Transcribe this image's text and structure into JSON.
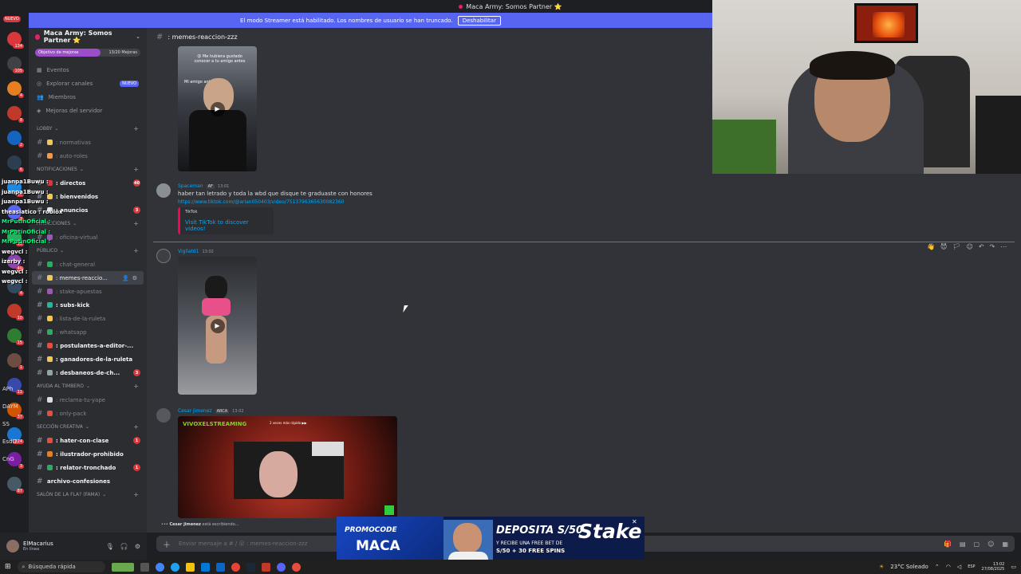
{
  "window": {
    "title": "Maca Army: Somos Partner ⭐"
  },
  "banner": {
    "text": "El modo Streamer está habilitado. Los nombres de usuario se han truncado.",
    "button": "Deshabilitar"
  },
  "rail": {
    "new_badge": "NUEVO",
    "badges": [
      "134",
      "105",
      "4",
      "8",
      "2",
      "6",
      "14",
      "3",
      "36",
      "40",
      "4",
      "10",
      "15",
      "1",
      "11",
      "37",
      "224",
      "3",
      "87"
    ],
    "labels": [
      "APh",
      "DAYM",
      "SS",
      "EsdD",
      "CnG"
    ]
  },
  "stream_chat": [
    {
      "name": "juanpa1Buwu :",
      "color": "#ffffff"
    },
    {
      "name": "juanpa1Buwu :",
      "color": "#ffffff"
    },
    {
      "name": "juanpa1Buwu :",
      "color": "#ffffff"
    },
    {
      "name": "theasiatico : roblox",
      "color": "#ffffff"
    },
    {
      "name": "MrPutinOficial :",
      "color": "#00ff7f"
    },
    {
      "name": "MrPutinOficial :",
      "color": "#00ff7f"
    },
    {
      "name": "MrPutinOficial :",
      "color": "#00ff7f"
    },
    {
      "name": "wegvcl :",
      "color": "#ffffff"
    },
    {
      "name": "izerby :",
      "color": "#ffffff"
    },
    {
      "name": "wegvcl :",
      "color": "#ffffff"
    },
    {
      "name": "wegvcl :",
      "color": "#ffffff"
    }
  ],
  "sidebar": {
    "server_name": "Maca Army: Somos Partner ⭐",
    "boost": {
      "label": "Objetivo de mejoras",
      "count": "13/20 Mejoras"
    },
    "nav": [
      {
        "label": "Eventos",
        "icon": "calendar-icon"
      },
      {
        "label": "Explorar canales",
        "icon": "compass-icon",
        "badge": "NUEVO"
      },
      {
        "label": "Miembros",
        "icon": "members-icon"
      },
      {
        "label": "Mejoras del servidor",
        "icon": "boost-icon"
      }
    ],
    "categories": [
      {
        "name": "LOBBY",
        "channels": [
          {
            "name": ": normativas",
            "unread": false,
            "emoji": "#f2c94c"
          },
          {
            "name": ": auto-roles",
            "unread": false,
            "emoji": "#f2994a"
          }
        ]
      },
      {
        "name": "NOTIFICACIONES",
        "channels": [
          {
            "name": ": directos",
            "unread": true,
            "emoji": "#da373c",
            "count": "40"
          },
          {
            "name": ": bienvenidos",
            "unread": true,
            "emoji": "#f2c94c"
          },
          {
            "name": ": anuncios",
            "unread": true,
            "emoji": "#dbdee1",
            "count": "3"
          }
        ]
      },
      {
        "name": "ATRACCIONES",
        "channels": [
          {
            "name": ": oficina-virtual",
            "unread": false,
            "emoji": "#9b59b6"
          }
        ]
      },
      {
        "name": "PÚBLICO",
        "channels": [
          {
            "name": ": chat-general",
            "unread": false,
            "emoji": "#27ae60"
          },
          {
            "name": ": memes-reaccio...",
            "unread": false,
            "emoji": "#f2c94c",
            "active": true
          },
          {
            "name": ": stake-apuestas",
            "unread": false,
            "emoji": "#9b59b6"
          },
          {
            "name": ": subs-kick",
            "unread": true,
            "emoji": "#1abc9c"
          },
          {
            "name": ": lista-de-la-ruleta",
            "unread": false,
            "emoji": "#f2c94c"
          },
          {
            "name": ": whatsapp",
            "unread": false,
            "emoji": "#27ae60"
          },
          {
            "name": ": postulantes-a-editor-...",
            "unread": true,
            "emoji": "#e74c3c"
          },
          {
            "name": ": ganadores-de-la-ruleta",
            "unread": true,
            "emoji": "#f2c94c"
          },
          {
            "name": ": desbaneos-de-ch...",
            "unread": true,
            "emoji": "#95a5a6",
            "count": "3"
          }
        ]
      },
      {
        "name": "AYUDA AL TIMBERO",
        "channels": [
          {
            "name": ": reclama-tu-yape",
            "unread": false,
            "emoji": "#dbdee1"
          },
          {
            "name": ": only-pack",
            "unread": false,
            "emoji": "#e74c3c"
          }
        ]
      },
      {
        "name": "SECCIÓN CREATIVA",
        "channels": [
          {
            "name": ": hater-con-clase",
            "unread": true,
            "emoji": "#e74c3c",
            "count": "1"
          },
          {
            "name": ": ilustrador-prohibido",
            "unread": true,
            "emoji": "#e67e22"
          },
          {
            "name": ": relator-tronchado",
            "unread": true,
            "emoji": "#27ae60",
            "count": "1"
          },
          {
            "name": "archivo-confesiones",
            "unread": true,
            "emoji": ""
          }
        ]
      },
      {
        "name": "SALÓN DE LA FLA? (FAMA)",
        "channels": []
      }
    ]
  },
  "user": {
    "name": "ElMacarius",
    "status": "En línea"
  },
  "channel": {
    "name": ": memes-reaccion-zzz"
  },
  "messages": [
    {
      "author": "Spaceman",
      "tag": "AF",
      "time": "13:01",
      "text": "haber tan letrado y toda la wbd que disque te graduaste con honores",
      "link": "https://www.tiktok.com/@arian050403/video/7513796365630082360",
      "embed": {
        "provider": "TikTok",
        "title": "Visit TikTok to discover videos!"
      }
    },
    {
      "author": "Vigilatd1",
      "tag": "",
      "time": "13:02"
    },
    {
      "author": "Cesar jimenez",
      "tag": "ARCA",
      "time": "13:02"
    }
  ],
  "video1": {
    "line1": "😮 Me hubiera gustado",
    "line2": "conocer a tu amigo antes",
    "line3": "Mi amigo antes :"
  },
  "video3": {
    "brand": "VIVOXELSTREAMING",
    "sub": "2 veces más rápido ▶▶"
  },
  "typing": {
    "user": "Cesar jimenez",
    "text": " está escribiendo..."
  },
  "composer": {
    "placeholder": "Enviar mensaje a # / 😮 : memes-reaccion-zzz"
  },
  "ad": {
    "promo": "PROMOCODE",
    "code": "MACA",
    "headline": "DEPOSITA S/50",
    "sub1": "Y RECIBE UNA FREE BET DE",
    "sub2": "S/50 + 30 FREE SPINS",
    "brand": "Stake"
  },
  "taskbar": {
    "search": "Búsqueda rápida",
    "weather": "23°C Soleado",
    "lang": "ESP",
    "time": "13:02",
    "date": "27/08/2025"
  },
  "colors": {
    "accent": "#5865f2",
    "link": "#00a8fc",
    "mention_badge": "#da373c",
    "new_line": "#f23f43"
  }
}
